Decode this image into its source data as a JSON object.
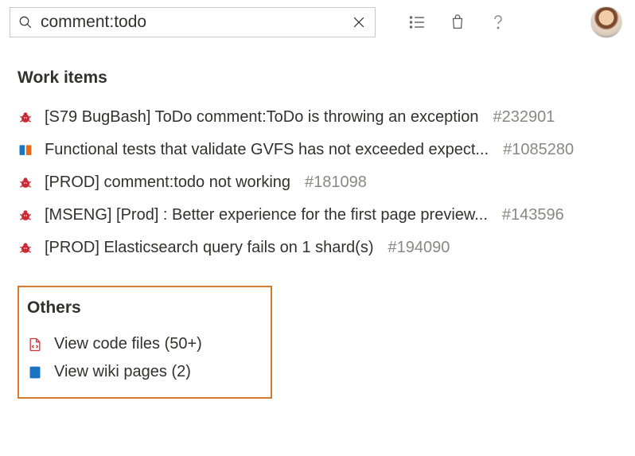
{
  "search": {
    "value": "comment:todo",
    "placeholder": ""
  },
  "sections": {
    "work_items_heading": "Work items",
    "others_heading": "Others"
  },
  "work_items": [
    {
      "icon": "bug",
      "title": "[S79 BugBash] ToDo comment:ToDo is throwing an exception",
      "id": "#232901"
    },
    {
      "icon": "book",
      "title": "Functional tests that validate GVFS has not exceeded expect...",
      "id": "#1085280"
    },
    {
      "icon": "bug",
      "title": "[PROD] comment:todo not working",
      "id": "#181098"
    },
    {
      "icon": "bug",
      "title": "[MSENG] [Prod] : Better experience for the first page preview...",
      "id": "#143596"
    },
    {
      "icon": "bug",
      "title": "[PROD] Elasticsearch query fails on 1 shard(s)",
      "id": "#194090"
    }
  ],
  "others": [
    {
      "icon": "code",
      "label": "View code files (50+)"
    },
    {
      "icon": "wiki",
      "label": "View wiki pages (2)"
    }
  ],
  "colors": {
    "bug": "#cc2936",
    "book": "#1b74c1",
    "code": "#d13438",
    "wiki": "#1b74c1",
    "highlight_border": "#d97b2e"
  }
}
